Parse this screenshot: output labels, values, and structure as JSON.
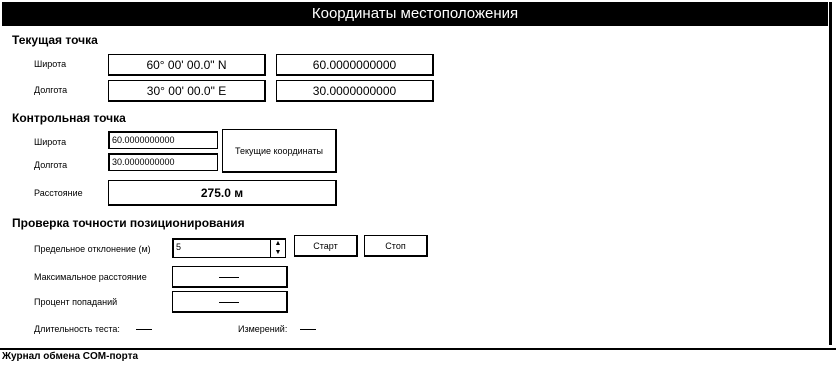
{
  "window": {
    "title": "Координаты местоположения"
  },
  "current_point": {
    "title": "Текущая точка",
    "lat_label": "Широта",
    "lon_label": "Долгота",
    "lat_dms": "60° 00' 00.0\" N",
    "lat_dec": "60.0000000000",
    "lon_dms": "30° 00' 00.0\" E",
    "lon_dec": "30.0000000000"
  },
  "control_point": {
    "title": "Контрольная точка",
    "lat_label": "Широта",
    "lon_label": "Долгота",
    "lat_value": "60.0000000000",
    "lon_value": "30.0000000000",
    "current_coords_button": "Текущие координаты",
    "distance_label": "Расстояние",
    "distance_value": "275.0 м"
  },
  "accuracy_check": {
    "title": "Проверка точности позиционирования",
    "max_deviation_label": "Предельное отклонение (м)",
    "max_deviation_value": "5",
    "start_button": "Старт",
    "stop_button": "Стоп",
    "max_distance_label": "Максимальное расстояние",
    "hit_percent_label": "Процент попаданий",
    "test_duration_label": "Длительность теста:",
    "measurements_label": "Измерений:"
  },
  "footer": {
    "label": "Журнал обмена COM-порта"
  }
}
